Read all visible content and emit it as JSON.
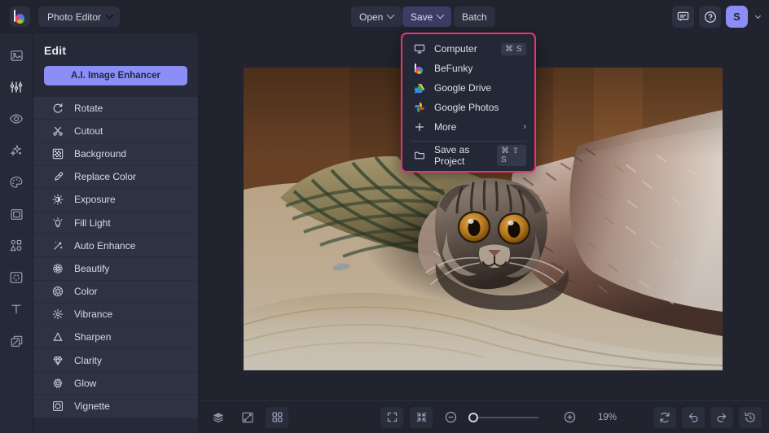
{
  "app": {
    "logo": "befunky-logo-icon",
    "switcher_label": "Photo Editor"
  },
  "toolbar": {
    "open_label": "Open",
    "save_label": "Save",
    "batch_label": "Batch",
    "avatar_initial": "S",
    "feedback_icon": "chat-icon",
    "help_icon": "help-circle-icon"
  },
  "save_menu": {
    "items": [
      {
        "label": "Computer",
        "icon": "monitor-icon",
        "shortcut": "⌘ S"
      },
      {
        "label": "BeFunky",
        "icon": "befunky-icon",
        "shortcut": ""
      },
      {
        "label": "Google Drive",
        "icon": "google-drive-icon",
        "shortcut": ""
      },
      {
        "label": "Google Photos",
        "icon": "google-photos-icon",
        "shortcut": ""
      },
      {
        "label": "More",
        "icon": "plus-icon",
        "shortcut": "",
        "arrow": "›"
      }
    ],
    "footer": {
      "label": "Save as Project",
      "icon": "folder-icon",
      "shortcut": "⌘ ⇧ S"
    },
    "highlight_color": "#e8336d"
  },
  "rail": {
    "items": [
      {
        "name": "image-icon",
        "active": false
      },
      {
        "name": "sliders-icon",
        "active": true
      },
      {
        "name": "eye-icon",
        "active": false
      },
      {
        "name": "sparkles-icon",
        "active": false
      },
      {
        "name": "artify-palette-icon",
        "active": false
      },
      {
        "name": "frames-icon",
        "active": false
      },
      {
        "name": "graphics-icon",
        "active": false
      },
      {
        "name": "overlays-icon",
        "active": false
      },
      {
        "name": "text-icon",
        "active": false
      },
      {
        "name": "layers-icon",
        "active": false
      }
    ]
  },
  "edit_panel": {
    "title": "Edit",
    "ai_button_label": "A.I. Image Enhancer",
    "ai_button_color": "#8b8ef5",
    "tools": [
      {
        "label": "Rotate",
        "icon": "rotate-icon"
      },
      {
        "label": "Cutout",
        "icon": "scissors-icon"
      },
      {
        "label": "Background",
        "icon": "checkerboard-icon"
      },
      {
        "label": "Replace Color",
        "icon": "eyedropper-icon"
      },
      {
        "label": "Exposure",
        "icon": "exposure-icon"
      },
      {
        "label": "Fill Light",
        "icon": "bulb-icon"
      },
      {
        "label": "Auto Enhance",
        "icon": "magic-wand-icon"
      },
      {
        "label": "Beautify",
        "icon": "beautify-icon"
      },
      {
        "label": "Color",
        "icon": "color-wheel-icon"
      },
      {
        "label": "Vibrance",
        "icon": "vibrance-icon"
      },
      {
        "label": "Sharpen",
        "icon": "sharpen-icon"
      },
      {
        "label": "Clarity",
        "icon": "diamond-icon"
      },
      {
        "label": "Glow",
        "icon": "glow-icon"
      },
      {
        "label": "Vignette",
        "icon": "vignette-icon"
      }
    ]
  },
  "bottom_bar": {
    "left_icons": [
      {
        "name": "layers-stack-icon",
        "boxed": false
      },
      {
        "name": "compare-icon",
        "boxed": false
      },
      {
        "name": "grid-view-icon",
        "boxed": true
      }
    ],
    "center_icons": [
      {
        "name": "fit-screen-icon",
        "boxed": true
      },
      {
        "name": "actual-size-icon",
        "boxed": true
      }
    ],
    "zoom_out_icon": "zoom-out-icon",
    "zoom_in_icon": "zoom-in-icon",
    "zoom_level": "19%",
    "right_icons": [
      {
        "name": "reset-icon",
        "boxed": true
      },
      {
        "name": "undo-icon",
        "boxed": true
      },
      {
        "name": "redo-icon",
        "boxed": true
      },
      {
        "name": "history-icon",
        "boxed": true
      }
    ]
  },
  "canvas": {
    "photo_alt": "Tabby cat peeking out from under a blanket on a sofa"
  }
}
